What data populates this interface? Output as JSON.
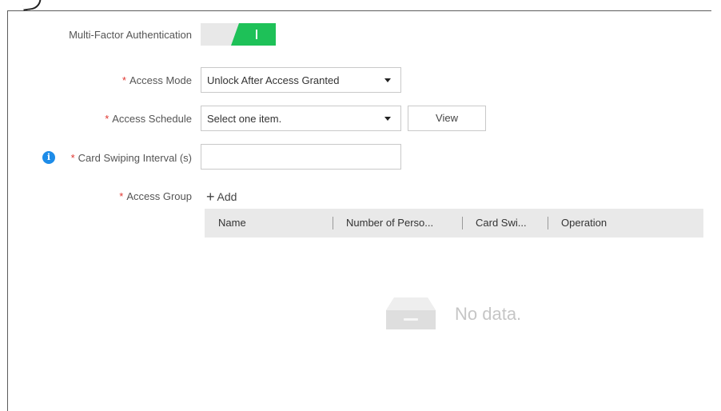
{
  "mfa": {
    "label": "Multi-Factor Authentication",
    "enabled": true,
    "toggle_color": "#1ec158"
  },
  "access_mode": {
    "required_mark": "*",
    "label": "Access Mode",
    "value": "Unlock After Access Granted"
  },
  "access_schedule": {
    "required_mark": "*",
    "label": "Access Schedule",
    "placeholder": "Select one item.",
    "view_label": "View"
  },
  "card_interval": {
    "info_icon": "info-icon",
    "required_mark": "*",
    "label": "Card Swiping Interval (s)",
    "value": ""
  },
  "access_group": {
    "required_mark": "*",
    "label": "Access Group",
    "add_label": "Add",
    "columns": [
      "Name",
      "Number of Perso...",
      "Card Swi...",
      "Operation"
    ],
    "rows": [],
    "empty_text": "No data."
  },
  "colors": {
    "required": "#e0352f",
    "info": "#1d8ce8",
    "header_bg": "#e9e9e9"
  }
}
